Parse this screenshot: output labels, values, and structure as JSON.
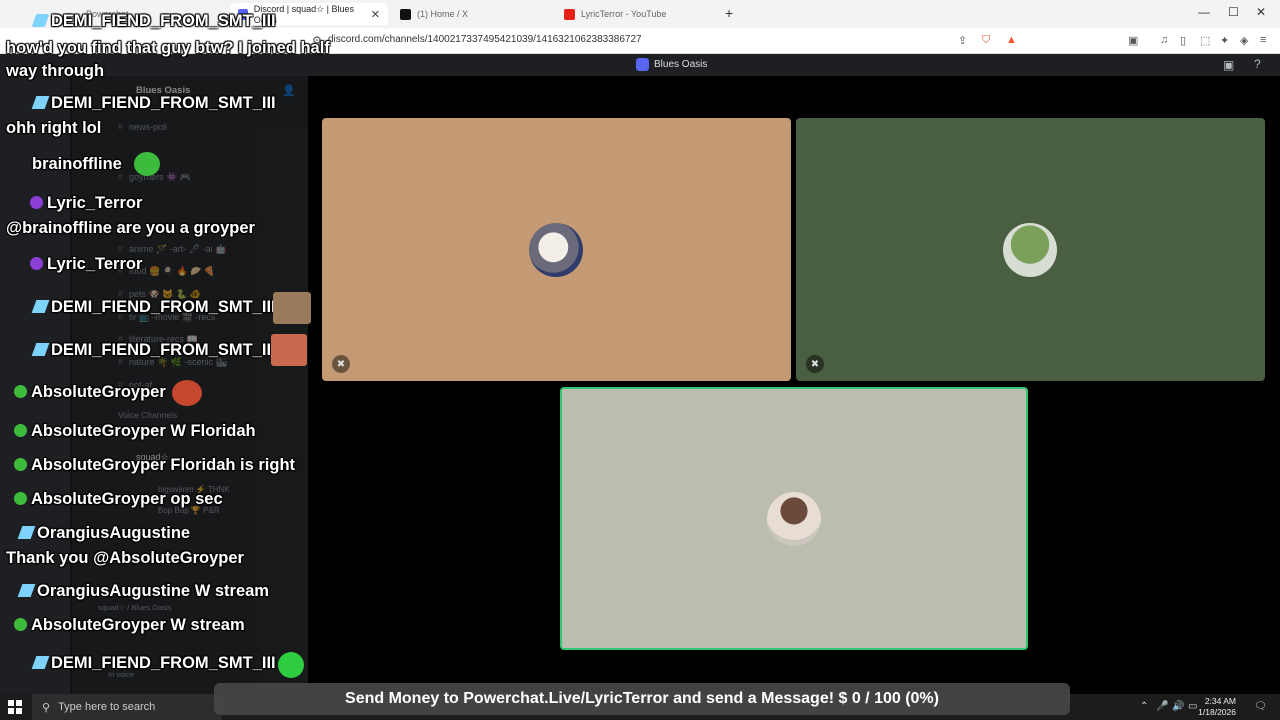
{
  "browser": {
    "tabs": [
      {
        "label": "Powerchat",
        "active": false
      },
      {
        "label": "Discord | squad☆ | Blues Oasis",
        "active": true
      },
      {
        "label": "(1) Home / X",
        "active": false
      },
      {
        "label": "LyricTerror - YouTube",
        "active": false
      }
    ],
    "new_tab": "+",
    "url": "discord.com/channels/1400217337495421039/1416321062383386727",
    "accent_color": "#fb542b"
  },
  "discord": {
    "server_name": "Blues Oasis",
    "channels": [
      {
        "label": "news-poli"
      },
      {
        "label": "goymers 👾 🎮"
      },
      {
        "label": "anime 🪄 -art- 🖊 -ai 🤖"
      },
      {
        "label": "food 🍔 🍳 🔥 🥟 🍕"
      },
      {
        "label": "pets 🐶 🐱 🐍 🐠"
      },
      {
        "label": "tv 📺 -movie 🎬 -recs"
      },
      {
        "label": "literature-recs 📖"
      },
      {
        "label": "nature 🌴 🌿 -scenic 🏙"
      },
      {
        "label": "not-af"
      }
    ],
    "voice_header": "Voice Channels",
    "voice_channel": "squad☆",
    "voice_users": [
      "bigswimm ⚡ THNK",
      "Bop Bop 🏆 P&R"
    ],
    "voice_status": "squad☆ / Blues Oasis",
    "voice_connected": "In voice",
    "tiles": [
      {
        "name": "tile-1",
        "color": "#c49a74"
      },
      {
        "name": "tile-2",
        "color": "#4a5e42"
      },
      {
        "name": "tile-3",
        "color": "#bbbdaf"
      }
    ]
  },
  "chat": [
    {
      "user": "DEMI_FIEND_FROM_SMT_III",
      "text": "",
      "user_color": "#ffffff"
    },
    {
      "user": "",
      "text": "how'd you find that guy btw? I joined half"
    },
    {
      "user": "",
      "text": "way through"
    },
    {
      "user": "DEMI_FIEND_FROM_SMT_III",
      "text": ""
    },
    {
      "user": "",
      "text": "ohh right lol"
    },
    {
      "user": "brainoffline",
      "text": ""
    },
    {
      "user": "Lyric_Terror",
      "text": ""
    },
    {
      "user": "",
      "text": "@brainoffline are you a groyper"
    },
    {
      "user": "Lyric_Terror",
      "text": ""
    },
    {
      "user": "DEMI_FIEND_FROM_SMT_III",
      "text": ""
    },
    {
      "user": "DEMI_FIEND_FROM_SMT_III",
      "text": ""
    },
    {
      "user": "AbsoluteGroyper",
      "text": ""
    },
    {
      "user": "AbsoluteGroyper",
      "text": "W Floridah"
    },
    {
      "user": "AbsoluteGroyper",
      "text": "Floridah is right"
    },
    {
      "user": "AbsoluteGroyper",
      "text": "op sec"
    },
    {
      "user": "OrangiusAugustine",
      "text": ""
    },
    {
      "user": "",
      "text": "Thank you @AbsoluteGroyper"
    },
    {
      "user": "OrangiusAugustine",
      "text": "W stream"
    },
    {
      "user": "AbsoluteGroyper",
      "text": "W stream"
    },
    {
      "user": "DEMI_FIEND_FROM_SMT_III",
      "text": ""
    }
  ],
  "donation": {
    "text": "Send Money to Powerchat.Live/LyricTerror and send a Message! $ 0 / 100 (0%)",
    "progress": 0
  },
  "taskbar": {
    "search_placeholder": "Type here to search",
    "time": "2:34 AM",
    "date": "1/18/2026"
  }
}
